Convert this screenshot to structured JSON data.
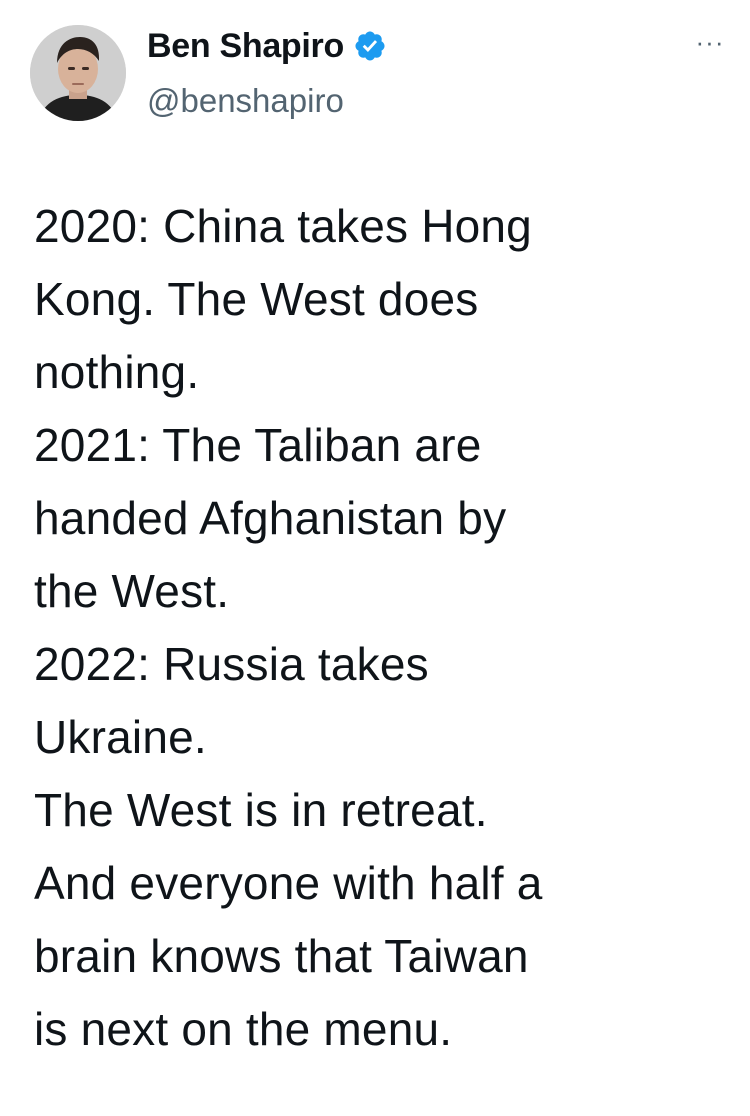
{
  "author": {
    "display_name": "Ben Shapiro",
    "handle": "@benshapiro",
    "verified": true,
    "verified_color": "#1d9bf0"
  },
  "menu": {
    "icon": "more-horizontal-icon",
    "label": "···"
  },
  "tweet": {
    "lines": [
      "2020: China takes Hong",
      "Kong. The West does",
      "nothing.",
      "2021: The Taliban are",
      "handed Afghanistan by",
      "the West.",
      "2022: Russia takes",
      "Ukraine.",
      "The West is in retreat.",
      "And everyone with half a",
      "brain knows that Taiwan",
      "is next on the menu."
    ]
  }
}
